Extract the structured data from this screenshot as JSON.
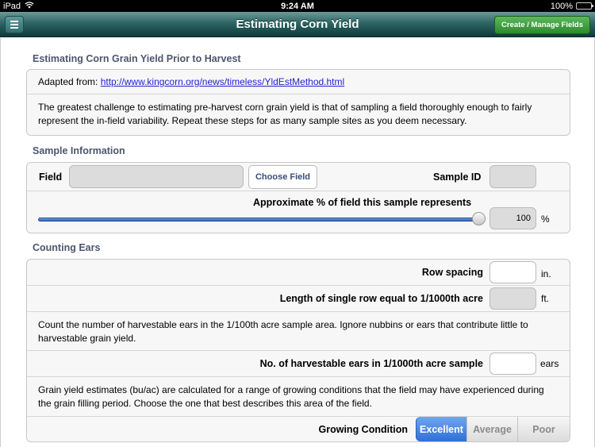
{
  "status_bar": {
    "device": "iPad",
    "time": "9:24 AM",
    "battery": "100%"
  },
  "nav": {
    "title": "Estimating Corn Yield",
    "menu_icon": "hamburger-menu-icon",
    "manage_button": "Create / Manage Fields"
  },
  "intro": {
    "header": "Estimating Corn Grain Yield Prior to Harvest",
    "adapted_label": "Adapted from:",
    "adapted_link": "http://www.kingcorn.org/news/timeless/YldEstMethod.html",
    "description": "The greatest challenge to estimating pre-harvest corn grain yield is that of sampling a field thoroughly enough to fairly represent the in-field variability. Repeat these steps for as many sample sites as you deem necessary."
  },
  "sample_info": {
    "header": "Sample Information",
    "field_label": "Field",
    "field_value": "",
    "choose_field_button": "Choose Field",
    "sample_id_label": "Sample ID",
    "sample_id_value": "",
    "percent_label": "Approximate % of field this sample represents",
    "percent_value": "100",
    "percent_unit": "%",
    "slider_percent": 100
  },
  "counting_ears": {
    "header": "Counting Ears",
    "row_spacing_label": "Row spacing",
    "row_spacing_value": "",
    "row_spacing_unit": "in.",
    "row_length_label": "Length of single row equal to 1/1000th acre",
    "row_length_value": "",
    "row_length_unit": "ft.",
    "count_instructions": "Count the number of harvestable ears in the 1/100th acre sample area.  Ignore nubbins or ears that contribute little to harvestable grain yield.",
    "ears_label": "No. of harvestable ears in 1/1000th acre sample",
    "ears_value": "",
    "ears_unit": "ears",
    "yield_instructions": "Grain yield estimates (bu/ac) are calculated for a range of growing conditions that the field may have experienced during the grain filling period. Choose the one that best describes this area of the field.",
    "growing_condition_label": "Growing Condition",
    "growing_condition_options": [
      "Excellent",
      "Average",
      "Poor"
    ],
    "growing_condition_selected": "Excellent"
  },
  "colors": {
    "nav_teal": "#2e6565",
    "manage_green": "#2d8a2d",
    "selected_blue": "#2f6fd8",
    "section_header": "#4c566c"
  }
}
